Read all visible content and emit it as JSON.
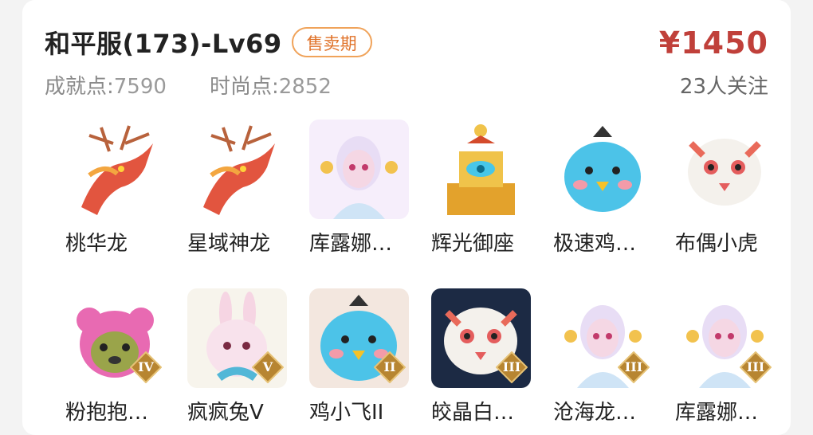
{
  "listing": {
    "title": "和平服(173)-Lv69",
    "status": "售卖期",
    "achievement_label": "成就点:",
    "achievement_value": "7590",
    "fashion_label": "时尚点:",
    "fashion_value": "2852",
    "price": "¥1450",
    "followers": "23人关注"
  },
  "items": [
    {
      "name": "桃华龙",
      "icon": "dragon-icon",
      "bg": "#ffffff",
      "badge": ""
    },
    {
      "name": "星域神龙",
      "icon": "dragon-icon",
      "bg": "#ffffff",
      "badge": ""
    },
    {
      "name": "库露娜…",
      "icon": "character-icon",
      "bg": "#f6eefb",
      "badge": ""
    },
    {
      "name": "辉光御座",
      "icon": "throne-icon",
      "bg": "#ffffff",
      "badge": ""
    },
    {
      "name": "极速鸡…",
      "icon": "chick-icon",
      "bg": "#ffffff",
      "badge": ""
    },
    {
      "name": "布偶小虎",
      "icon": "tiger-icon",
      "bg": "#ffffff",
      "badge": ""
    },
    {
      "name": "粉抱抱…",
      "icon": "bear-icon",
      "bg": "#ffffff",
      "badge": "IV"
    },
    {
      "name": "疯疯兔V",
      "icon": "rabbit-icon",
      "bg": "#f7f4ec",
      "badge": "V"
    },
    {
      "name": "鸡小飞II",
      "icon": "chick-icon",
      "bg": "#f3e7df",
      "badge": "II"
    },
    {
      "name": "皎晶白…",
      "icon": "tiger-icon",
      "bg": "#1c2a44",
      "badge": "III"
    },
    {
      "name": "沧海龙…",
      "icon": "character-icon",
      "bg": "#ffffff",
      "badge": "III"
    },
    {
      "name": "库露娜…",
      "icon": "character-icon",
      "bg": "#ffffff",
      "badge": "III"
    }
  ]
}
